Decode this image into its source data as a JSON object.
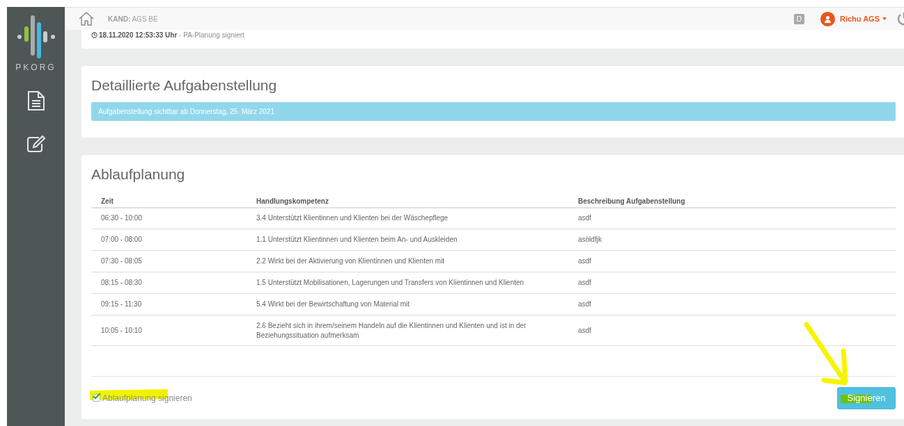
{
  "sidebar": {
    "logo_text": "PKORG"
  },
  "header": {
    "label": "KAND:",
    "value": "AGS BE",
    "badge": "D",
    "user": "Richu AGS"
  },
  "status_card": {
    "timestamp": "18.11.2020 12:53:33 Uhr",
    "text": "- PA-Planung signiert"
  },
  "task_card": {
    "title": "Detaillierte Aufgabenstellung",
    "notice": "Aufgabenstellung sichtbar ab Donnerstag, 25. März 2021"
  },
  "schedule": {
    "title": "Ablaufplanung",
    "columns": [
      "Zeit",
      "Handlungskompetenz",
      "Beschreibung Aufgabenstellung"
    ],
    "rows": [
      [
        "06:30 - 10:00",
        "3.4 Unterstützt Klientinnen und Klienten bei der Wäschepflege",
        "asdf"
      ],
      [
        "07:00 - 08:00",
        "1.1 Unterstützt Klientinnen und Klienten beim An- und Auskleiden",
        "asöldfjk"
      ],
      [
        "07:30 - 08:05",
        "2.2 Wirkt bei der Aktivierung von Klientinnen und Klienten mit",
        "asdf"
      ],
      [
        "08:15 - 08:30",
        "1.5 Unterstützt Mobilisationen, Lagerungen und Transfers von Klientinnen und Klienten",
        "asdf"
      ],
      [
        "09:15 - 11:30",
        "5.4 Wirkt bei der Bewirtschaftung von Material mit",
        "asdf"
      ],
      [
        "10:05 - 10:10",
        "2.6 Bezieht sich in ihrem/seinem Handeln auf die Klientinnen und Klienten und ist in der Beziehungssituation aufmerksam",
        "asdf"
      ]
    ],
    "sign_checkbox": {
      "label": "Ablaufplanung signieren",
      "checked": true
    },
    "sign_button": "Signieren"
  }
}
